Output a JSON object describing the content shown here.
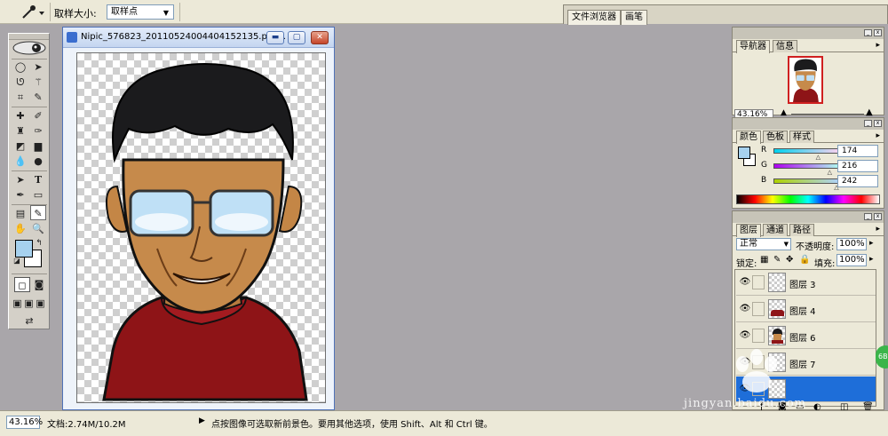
{
  "options_bar": {
    "tool_preset_icon": "eyedropper-icon",
    "sample_size_label": "取样大小:",
    "sample_size_value": "取样点",
    "palette_tabs": [
      "文件浏览器",
      "画笔"
    ]
  },
  "toolbox": {
    "tools": [
      "marquee-icon",
      "move-icon",
      "lasso-icon",
      "magic-wand-icon",
      "crop-icon",
      "slice-icon",
      "healing-icon",
      "brush-icon",
      "stamp-icon",
      "history-brush-icon",
      "eraser-icon",
      "gradient-icon",
      "blur-icon",
      "dodge-icon",
      "path-select-icon",
      "type-icon",
      "pen-icon",
      "shape-icon",
      "notes-icon",
      "eyedropper-icon",
      "hand-icon",
      "zoom-icon"
    ],
    "foreground_color": "#a6d1ee",
    "background_color": "#ffffff"
  },
  "document": {
    "title": "Nipic_576823_20110524004404152135.psd..."
  },
  "navigator_panel": {
    "tabs": [
      "导航器",
      "信息"
    ],
    "zoom": "43.16%"
  },
  "color_panel": {
    "tabs": [
      "颜色",
      "色板",
      "样式"
    ],
    "channels": [
      {
        "label": "R",
        "value": "174",
        "level": 0.68
      },
      {
        "label": "G",
        "value": "216",
        "level": 0.85
      },
      {
        "label": "B",
        "value": "242",
        "level": 0.95
      }
    ]
  },
  "layers_panel": {
    "tabs": [
      "图层",
      "通道",
      "路径"
    ],
    "blend_mode": "正常",
    "opacity_label": "不透明度:",
    "opacity_value": "100%",
    "lock_label": "锁定:",
    "fill_label": "填充:",
    "fill_value": "100%",
    "layers": [
      {
        "name": "图层 3",
        "selected": false
      },
      {
        "name": "图层 4",
        "selected": false
      },
      {
        "name": "图层 6",
        "selected": false
      },
      {
        "name": "图层 7",
        "selected": false
      },
      {
        "name": "",
        "selected": true
      }
    ]
  },
  "status_bar": {
    "zoom": "43.16%",
    "doc_info": "文档:2.74M/10.2M",
    "hint": "点按图像可选取新前景色。要用其他选项，使用 Shift、Alt 和 Ctrl 键。"
  },
  "watermark": "jingyan.baidu.com",
  "badge": "6B"
}
